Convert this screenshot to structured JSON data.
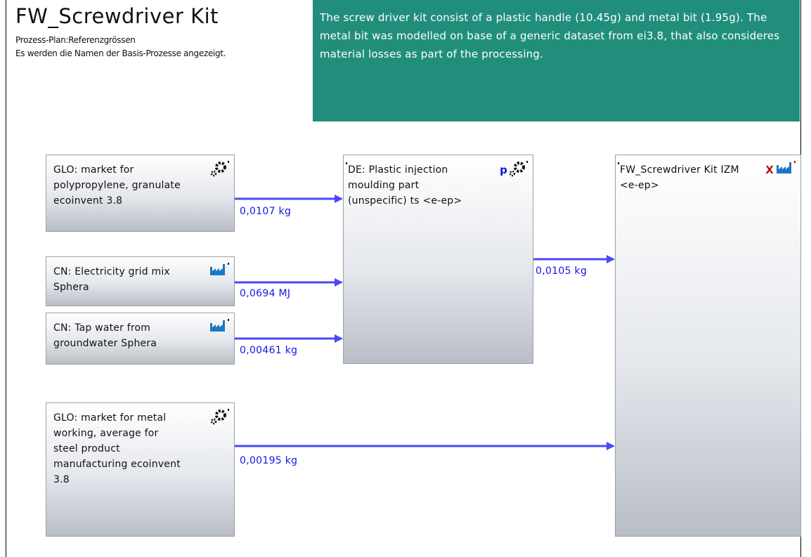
{
  "header": {
    "title": "FW_Screwdriver Kit",
    "subtitle1": "Prozess-Plan:Referenzgrössen",
    "subtitle2": "Es werden die Namen der Basis-Prozesse angezeigt."
  },
  "note": {
    "text": "The screw driver kit consist of a plastic handle (10.45g) and metal bit (1.95g). The metal bit was modelled on base of a generic dataset from ei3.8, that also consideres material losses as part of the processing."
  },
  "processes": {
    "pp": {
      "label": "GLO: market for polypropylene, granulate ecoinvent 3.8",
      "icon": "gear-icon"
    },
    "elec": {
      "label": "CN: Electricity grid mix Sphera",
      "icon": "factory-icon"
    },
    "water": {
      "label": "CN: Tap water from groundwater Sphera",
      "icon": "factory-icon"
    },
    "metal": {
      "label": "GLO: market for metal working, average for steel product manufacturing ecoinvent 3.8",
      "icon": "gear-icon"
    },
    "inj": {
      "label": "DE: Plastic injection moulding part (unspecific) ts <e-ep>",
      "icon": "parameter-gear-icon",
      "badge": "p"
    },
    "kit": {
      "label": "FW_Screwdriver Kit IZM <e-ep>",
      "icon": "factory-icon",
      "badge": "X"
    }
  },
  "flows": {
    "pp_inj": "0,0107 kg",
    "elec_inj": "0,0694 MJ",
    "water_inj": "0,00461 kg",
    "inj_kit": "0,0105 kg",
    "metal_kit": "0,00195 kg"
  },
  "colors": {
    "note_bg": "#218e7c",
    "flow": "#1515e6",
    "arrow": "#4a4af5"
  }
}
